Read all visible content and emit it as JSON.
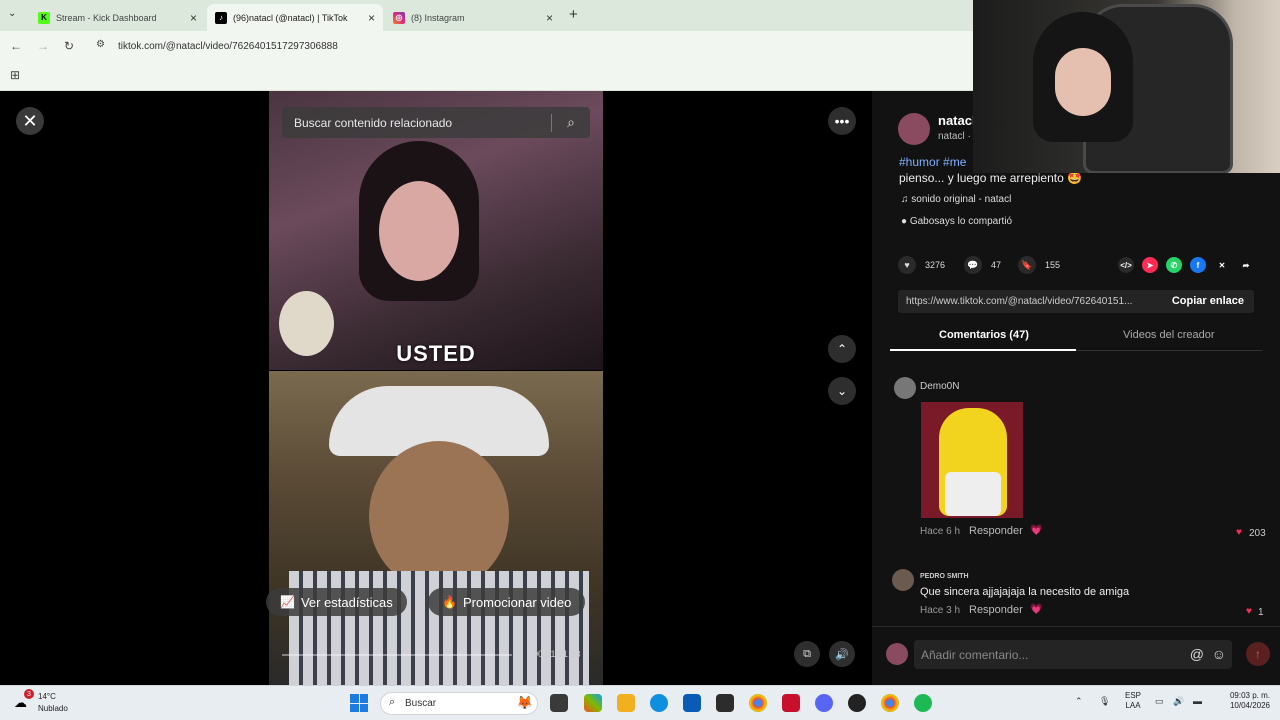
{
  "browser": {
    "tabs": [
      {
        "label": "Stream - Kick Dashboard",
        "icon": "kick-icon",
        "color": "#53fc18"
      },
      {
        "label": "(96)natacl (@natacl) | TikTok",
        "icon": "tiktok-icon",
        "color": "#000000"
      },
      {
        "label": "(8) Instagram",
        "icon": "instagram-icon",
        "color": "#dd2a7b"
      }
    ],
    "url": "tiktok.com/@natacl/video/7626401517297306888"
  },
  "player": {
    "search_placeholder": "Buscar contenido relacionado",
    "caption_overlay": "USTED",
    "stats_button": "Ver estadísticas",
    "promote_button": "Promocionar video",
    "timecode": "00:01/01:03"
  },
  "sidebar": {
    "author_name": "natacl",
    "author_sub": "natacl ·",
    "hashtag": "#humor #me",
    "caption": "pienso... y luego me arrepiento 🤩",
    "music": "sonido original - natacl",
    "shared_by": "Gabosays lo compartió",
    "likes": "3276",
    "comments": "47",
    "saves": "155",
    "link_url": "https://www.tiktok.com/@natacl/video/762640151...",
    "copy_link": "Copiar enlace",
    "tab_comments": "Comentarios (47)",
    "tab_creator": "Videos del creador",
    "comment_list": [
      {
        "user": "Demo0N",
        "time": "Hace 6 h",
        "reply": "Responder",
        "likes": "203",
        "text": ""
      },
      {
        "user": "PEDRO SMITH",
        "time": "Hace 3 h",
        "reply": "Responder",
        "likes": "1",
        "text": "Que sincera ajjajajaja la necesito de amiga"
      }
    ],
    "add_comment_placeholder": "Añadir comentario..."
  },
  "taskbar": {
    "weather_temp": "14°C",
    "weather_desc": "Nublado",
    "weather_badge": "3",
    "search_label": "Buscar",
    "lang_1": "ESP",
    "lang_2": "LAA",
    "time": "09:03 p. m.",
    "date": "10/04/2026"
  }
}
